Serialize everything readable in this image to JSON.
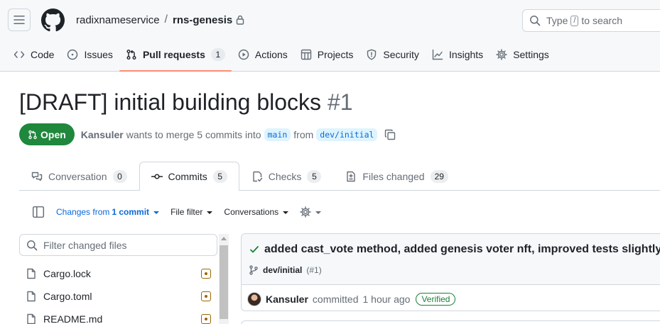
{
  "header": {
    "owner": "radixnameservice",
    "separator": "/",
    "repo": "rns-genesis",
    "search": {
      "prefix": "Type",
      "key": "/",
      "suffix": "to search"
    }
  },
  "repo_nav": [
    {
      "label": "Code",
      "icon": "code-icon"
    },
    {
      "label": "Issues",
      "icon": "issue-opened-icon"
    },
    {
      "label": "Pull requests",
      "icon": "git-pull-request-icon",
      "count": "1",
      "selected": true
    },
    {
      "label": "Actions",
      "icon": "play-icon"
    },
    {
      "label": "Projects",
      "icon": "table-icon"
    },
    {
      "label": "Security",
      "icon": "shield-icon"
    },
    {
      "label": "Insights",
      "icon": "graph-icon"
    },
    {
      "label": "Settings",
      "icon": "gear-icon"
    }
  ],
  "pr": {
    "title": "[DRAFT] initial building blocks",
    "number": "#1",
    "state": "Open",
    "author": "Kansuler",
    "meta_text": "wants to merge 5 commits into",
    "base_branch": "main",
    "from_text": "from",
    "head_branch": "dev/initial"
  },
  "tabs": [
    {
      "label": "Conversation",
      "count": "0",
      "icon": "comment-discussion-icon"
    },
    {
      "label": "Commits",
      "count": "5",
      "icon": "git-commit-icon",
      "active": true
    },
    {
      "label": "Checks",
      "count": "5",
      "icon": "checklist-icon"
    },
    {
      "label": "Files changed",
      "count": "29",
      "icon": "file-diff-icon"
    }
  ],
  "toolbar": {
    "changes_prefix": "Changes from",
    "changes_strong": "1 commit",
    "file_filter": "File filter",
    "conversations": "Conversations"
  },
  "file_tree": {
    "filter_placeholder": "Filter changed files",
    "files": [
      {
        "name": "Cargo.lock",
        "status": "modified"
      },
      {
        "name": "Cargo.toml",
        "status": "modified"
      },
      {
        "name": "README.md",
        "status": "modified"
      }
    ]
  },
  "commit": {
    "title": "added cast_vote method, added genesis voter nft, improved tests slightly",
    "branch": "dev/initial",
    "pr_ref": "(#1)",
    "author": "Kansuler",
    "action": "committed",
    "time": "1 hour ago",
    "verified": "Verified"
  },
  "colors": {
    "open_green": "#1f883d",
    "link_blue": "#0969da",
    "nav_underline": "#fd8c73",
    "modified_amber": "#9a6700"
  }
}
